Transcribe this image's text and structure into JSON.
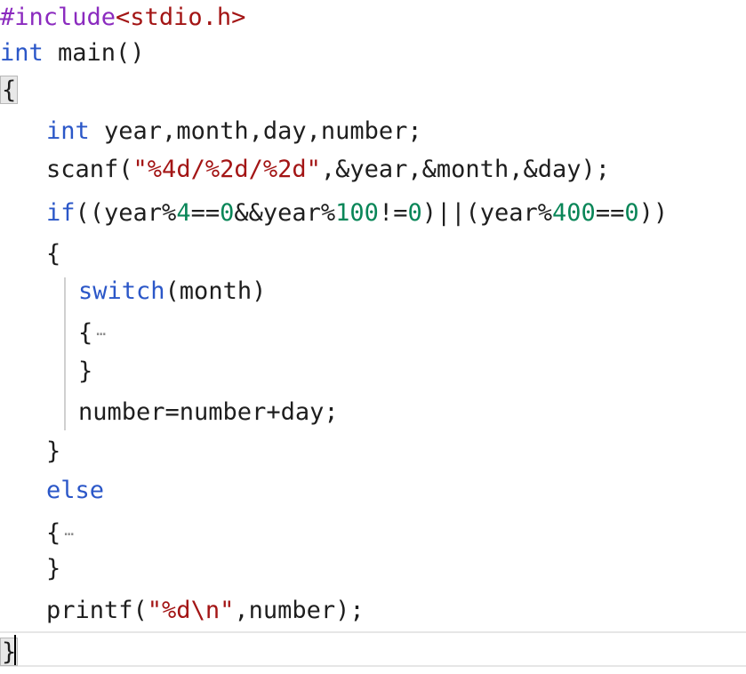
{
  "editor": {
    "colors": {
      "keyword": "#2b57c8",
      "text": "#1e1e1e",
      "string": "#a31515",
      "number": "#098658",
      "preprocessor": "#8b2bbf",
      "fold": "#8a8a8a"
    },
    "lines": [
      {
        "indent": 0,
        "tokens": [
          {
            "t": "#include",
            "c": "preprocessor"
          },
          {
            "t": "<stdio.h>",
            "c": "string"
          }
        ]
      },
      {
        "indent": 0,
        "tokens": [
          {
            "t": "int",
            "c": "keyword"
          },
          {
            "t": " main()",
            "c": "text"
          }
        ]
      },
      {
        "indent": 0,
        "tokens": [
          {
            "t": "{",
            "c": "text",
            "boxed": true
          }
        ]
      },
      {
        "indent": 1,
        "tokens": [
          {
            "t": "int",
            "c": "keyword"
          },
          {
            "t": " year,month,day,number;",
            "c": "text"
          }
        ]
      },
      {
        "indent": 1,
        "tokens": [
          {
            "t": "scanf(",
            "c": "text"
          },
          {
            "t": "\"%4d/%2d/%2d\"",
            "c": "string"
          },
          {
            "t": ",&year,&month,&day);",
            "c": "text"
          }
        ]
      },
      {
        "indent": 1,
        "tokens": [
          {
            "t": "if",
            "c": "keyword"
          },
          {
            "t": "((year%",
            "c": "text"
          },
          {
            "t": "4",
            "c": "number"
          },
          {
            "t": "==",
            "c": "text"
          },
          {
            "t": "0",
            "c": "number"
          },
          {
            "t": "&&year%",
            "c": "text"
          },
          {
            "t": "100",
            "c": "number"
          },
          {
            "t": "!=",
            "c": "text"
          },
          {
            "t": "0",
            "c": "number"
          },
          {
            "t": ")||(year%",
            "c": "text"
          },
          {
            "t": "400",
            "c": "number"
          },
          {
            "t": "==",
            "c": "text"
          },
          {
            "t": "0",
            "c": "number"
          },
          {
            "t": "))",
            "c": "text"
          }
        ]
      },
      {
        "indent": 1,
        "tokens": [
          {
            "t": "{",
            "c": "text"
          }
        ]
      },
      {
        "indent": 2,
        "tokens": [
          {
            "t": "switch",
            "c": "keyword"
          },
          {
            "t": "(month)",
            "c": "text"
          }
        ]
      },
      {
        "indent": 2,
        "tokens": [
          {
            "t": "{",
            "c": "text"
          },
          {
            "t": "…",
            "c": "fold",
            "collapsed": true
          }
        ]
      },
      {
        "indent": 2,
        "tokens": [
          {
            "t": "}",
            "c": "text"
          }
        ]
      },
      {
        "indent": 2,
        "tokens": [
          {
            "t": "number=number+day;",
            "c": "text"
          }
        ]
      },
      {
        "indent": 1,
        "tokens": [
          {
            "t": "}",
            "c": "text"
          }
        ]
      },
      {
        "indent": 1,
        "tokens": [
          {
            "t": "else",
            "c": "keyword"
          }
        ]
      },
      {
        "indent": 1,
        "tokens": [
          {
            "t": "{",
            "c": "text"
          },
          {
            "t": "…",
            "c": "fold",
            "collapsed": true
          }
        ]
      },
      {
        "indent": 1,
        "tokens": [
          {
            "t": "}",
            "c": "text"
          }
        ]
      },
      {
        "indent": 1,
        "tokens": [
          {
            "t": "printf(",
            "c": "text"
          },
          {
            "t": "\"%d\\n\"",
            "c": "string"
          },
          {
            "t": ",number);",
            "c": "text"
          }
        ]
      },
      {
        "indent": 0,
        "tokens": [
          {
            "t": "}",
            "c": "text",
            "boxed": true
          }
        ]
      }
    ]
  }
}
